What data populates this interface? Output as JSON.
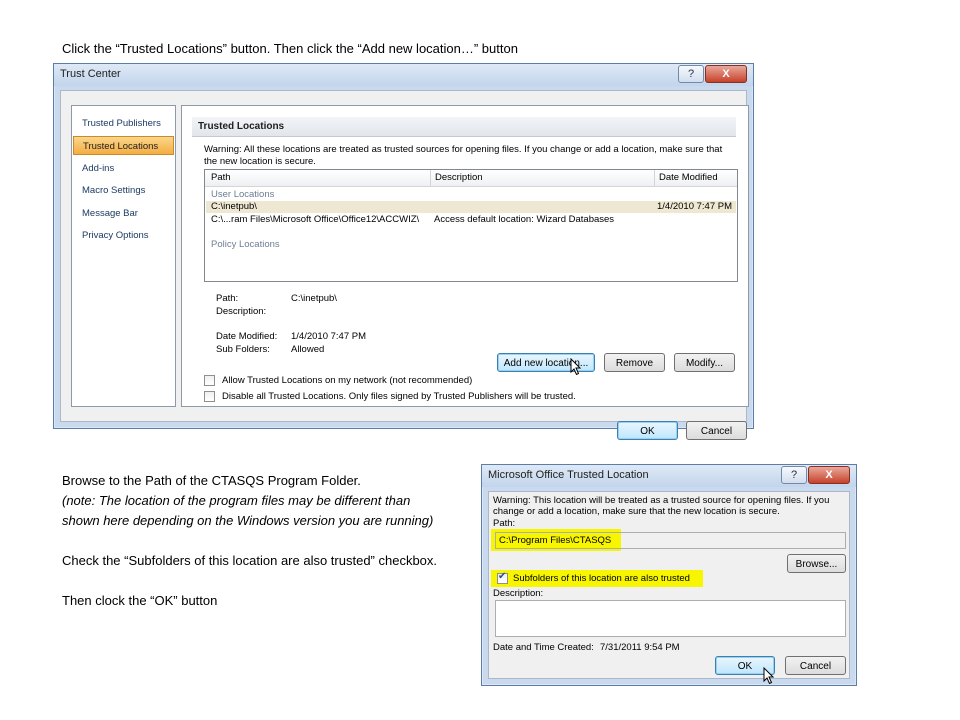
{
  "instructions": {
    "top": "Click the “Trusted Locations” button.  Then click the “Add new location…” button",
    "browse": "Browse to the Path of the CTASQS Program Folder.",
    "note": "(note: The location of the program files may be different than shown here depending on the Windows version you are running)",
    "check": "Check the “Subfolders of this location are also trusted” checkbox.",
    "ok": "Then clock the “OK” button"
  },
  "trust_center": {
    "title": "Trust Center",
    "help_icon": "?",
    "close_icon": "X",
    "sidebar": [
      {
        "label": "Trusted Publishers"
      },
      {
        "label": "Trusted Locations"
      },
      {
        "label": "Add-ins"
      },
      {
        "label": "Macro Settings"
      },
      {
        "label": "Message Bar"
      },
      {
        "label": "Privacy Options"
      }
    ],
    "section_title": "Trusted Locations",
    "warning": "Warning: All these locations are treated as trusted sources for opening files.  If you change or add a location, make sure that the new location is secure.",
    "columns": {
      "path": "Path",
      "description": "Description",
      "date_modified": "Date Modified"
    },
    "groups": {
      "user": "User Locations",
      "policy": "Policy Locations"
    },
    "rows": [
      {
        "path": "C:\\inetpub\\",
        "description": "",
        "date_modified": "1/4/2010 7:47 PM"
      },
      {
        "path": "C:\\...ram Files\\Microsoft Office\\Office12\\ACCWIZ\\",
        "description": "Access default location: Wizard Databases",
        "date_modified": ""
      }
    ],
    "details": {
      "path_label": "Path:",
      "path_value": "C:\\inetpub\\",
      "description_label": "Description:",
      "date_label": "Date Modified:",
      "date_value": "1/4/2010 7:47 PM",
      "subfolders_label": "Sub Folders:",
      "subfolders_value": "Allowed"
    },
    "buttons": {
      "add": "Add new location...",
      "remove": "Remove",
      "modify": "Modify...",
      "ok": "OK",
      "cancel": "Cancel"
    },
    "checkboxes": {
      "network": {
        "label": "Allow Trusted Locations on my network (not recommended)",
        "checked": false
      },
      "disable": {
        "label": "Disable all Trusted Locations. Only files signed by Trusted Publishers will be trusted.",
        "checked": false
      }
    }
  },
  "trusted_location_dialog": {
    "title": "Microsoft Office Trusted Location",
    "help_icon": "?",
    "close_icon": "X",
    "warning": "Warning: This location will be treated as a trusted source for opening files. If you change or add a location, make sure that the new location is secure.",
    "path_label": "Path:",
    "path_value": "C:\\Program Files\\CTASQS",
    "browse_button": "Browse...",
    "subfolders": {
      "label": "Subfolders of this location are also trusted",
      "checked": true
    },
    "description_label": "Description:",
    "description_value": "",
    "date_label": "Date and Time Created:",
    "date_value": "7/31/2011 9:54 PM",
    "ok_button": "OK",
    "cancel_button": "Cancel",
    "highlight_color": "#f7f500"
  }
}
